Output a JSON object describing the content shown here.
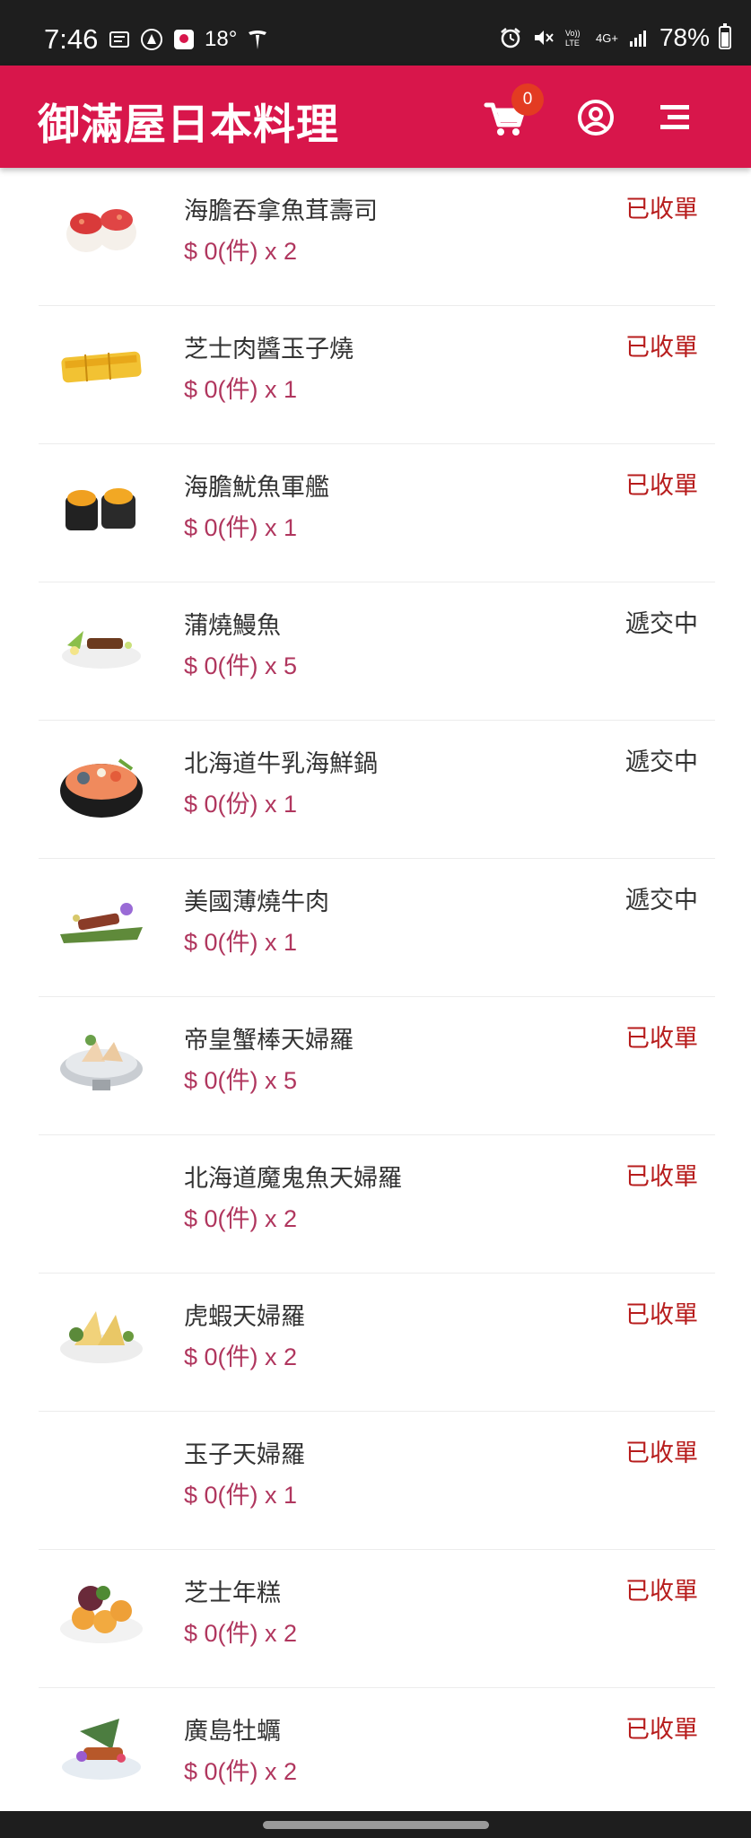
{
  "status_bar": {
    "time": "7:46",
    "temperature": "18°",
    "network": "4G+",
    "battery": "78%"
  },
  "header": {
    "title": "御滿屋日本料理",
    "cart_count": "0"
  },
  "colors": {
    "header": "#d8164b",
    "price": "#b0365e",
    "status_done": "#b71c1c",
    "status_pending": "#333333",
    "badge": "#e33b22"
  },
  "items": [
    {
      "name": "海膽吞拿魚茸壽司",
      "price": "$ 0(件) x 2",
      "status": "已收單",
      "status_type": "done",
      "has_image": true
    },
    {
      "name": "芝士肉醬玉子燒",
      "price": "$ 0(件) x 1",
      "status": "已收單",
      "status_type": "done",
      "has_image": true
    },
    {
      "name": "海膽魷魚軍艦",
      "price": "$ 0(件) x 1",
      "status": "已收單",
      "status_type": "done",
      "has_image": true
    },
    {
      "name": "蒲燒鰻魚",
      "price": "$ 0(件) x 5",
      "status": "遞交中",
      "status_type": "pending",
      "has_image": true
    },
    {
      "name": "北海道牛乳海鮮鍋",
      "price": "$ 0(份) x 1",
      "status": "遞交中",
      "status_type": "pending",
      "has_image": true
    },
    {
      "name": "美國薄燒牛肉",
      "price": "$ 0(件) x 1",
      "status": "遞交中",
      "status_type": "pending",
      "has_image": true
    },
    {
      "name": "帝皇蟹棒天婦羅",
      "price": "$ 0(件) x 5",
      "status": "已收單",
      "status_type": "done",
      "has_image": true
    },
    {
      "name": "北海道魔鬼魚天婦羅",
      "price": "$ 0(件) x 2",
      "status": "已收單",
      "status_type": "done",
      "has_image": false
    },
    {
      "name": "虎蝦天婦羅",
      "price": "$ 0(件) x 2",
      "status": "已收單",
      "status_type": "done",
      "has_image": true
    },
    {
      "name": "玉子天婦羅",
      "price": "$ 0(件) x 1",
      "status": "已收單",
      "status_type": "done",
      "has_image": false
    },
    {
      "name": "芝士年糕",
      "price": "$ 0(件) x 2",
      "status": "已收單",
      "status_type": "done",
      "has_image": true
    },
    {
      "name": "廣島牡蠣",
      "price": "$ 0(件) x 2",
      "status": "已收單",
      "status_type": "done",
      "has_image": true
    }
  ]
}
